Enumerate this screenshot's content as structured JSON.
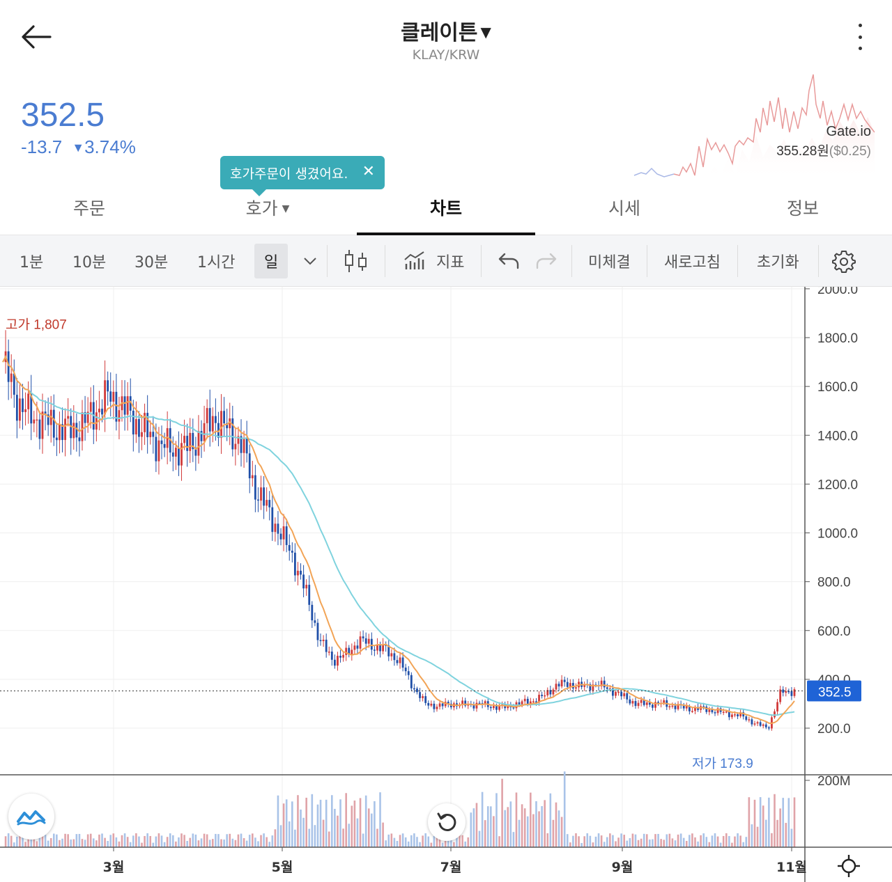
{
  "header": {
    "coin_name": "클레이튼",
    "pair": "KLAY/KRW"
  },
  "price": {
    "current": "352.5",
    "change_abs": "-13.7",
    "change_pct": "3.74%"
  },
  "reference": {
    "exchange": "Gate.io",
    "price_krw": "355.28원",
    "price_usd": "($0.25)"
  },
  "tooltip": {
    "text": "호가주문이 생겼어요."
  },
  "tabs": [
    {
      "label": "주문"
    },
    {
      "label": "호가"
    },
    {
      "label": "차트"
    },
    {
      "label": "시세"
    },
    {
      "label": "정보"
    }
  ],
  "toolbar": {
    "intervals": [
      "1분",
      "10분",
      "30분",
      "1시간",
      "일"
    ],
    "indicator_label": "지표",
    "unfilled_label": "미체결",
    "refresh_label": "새로고침",
    "reset_label": "초기화"
  },
  "colors": {
    "accent_blue": "#4a7cd1",
    "rise_red": "#d13a3a",
    "fall_blue": "#1f4fa8",
    "ma_short": "#f2a456",
    "ma_long": "#7fd3de",
    "tooltip_teal": "#3aabb7"
  },
  "chart_data": {
    "type": "candlestick",
    "x_ticks": [
      "3월",
      "5월",
      "7월",
      "9월",
      "11월"
    ],
    "y_ticks": [
      "200.0",
      "400.0",
      "600.0",
      "800.0",
      "1000.0",
      "1200.0",
      "1400.0",
      "1600.0",
      "1800.0",
      "2000.0"
    ],
    "ylim": [
      0,
      2000
    ],
    "current_price": 352.5,
    "current_price_label": "352.5",
    "high": 1807,
    "high_label": "고가 1,807",
    "low": 173.9,
    "low_label": "저가 173.9",
    "volume_tick": "200M",
    "series_close_approx": [
      1700,
      1550,
      1480,
      1460,
      1430,
      1420,
      1440,
      1500,
      1560,
      1520,
      1460,
      1400,
      1360,
      1340,
      1350,
      1400,
      1480,
      1420,
      1380,
      1200,
      1100,
      1000,
      900,
      750,
      560,
      480,
      500,
      560,
      540,
      520,
      480,
      380,
      300,
      290,
      300,
      295,
      300,
      290,
      285,
      300,
      310,
      330,
      380,
      380,
      370,
      380,
      360,
      330,
      300,
      300,
      300,
      290,
      280,
      280,
      270,
      260,
      250,
      220,
      200,
      350,
      352.5
    ]
  }
}
